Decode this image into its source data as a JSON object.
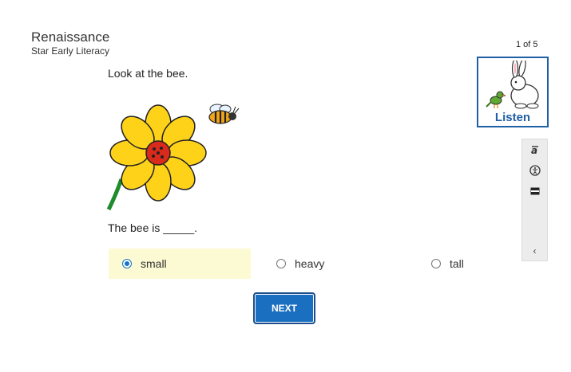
{
  "brand": {
    "name": "Renaissance",
    "product": "Star Early Literacy"
  },
  "progress": {
    "label": "1 of 5",
    "current": 1,
    "total": 5
  },
  "question": {
    "prompt": "Look at the bee.",
    "stem": "The bee is _____."
  },
  "choices": [
    {
      "label": "small",
      "selected": true
    },
    {
      "label": "heavy",
      "selected": false
    },
    {
      "label": "tall",
      "selected": false
    }
  ],
  "next_button": {
    "label": "NEXT"
  },
  "listen_button": {
    "label": "Listen"
  },
  "toolbar": {
    "tools": [
      "translate-icon",
      "accessibility-icon",
      "line-reader-icon"
    ],
    "collapse_glyph": "‹"
  },
  "colors": {
    "accent": "#1a6fc0",
    "selected_bg": "#fbfad2",
    "listen_border": "#1f5fa6"
  }
}
